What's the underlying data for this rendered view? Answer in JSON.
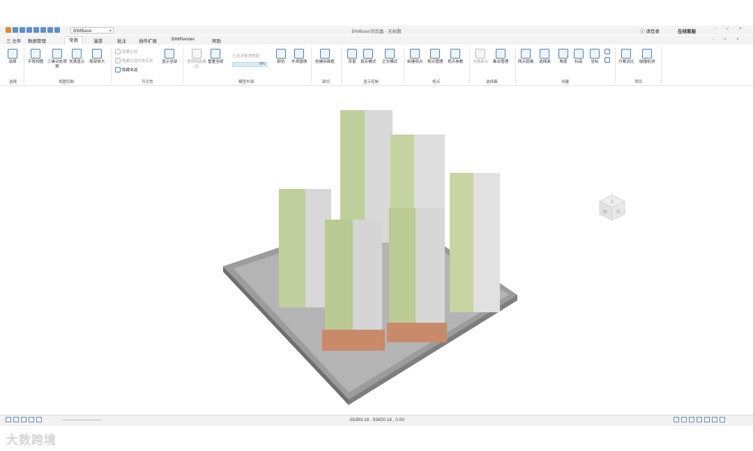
{
  "title_bar": {
    "workspace_combo": "BIMBase",
    "window_title": "BIMBase浏览器 - 无标题",
    "login": "请登录",
    "online_help": "在线客服",
    "window_controls": "- ♂ ×"
  },
  "menu": {
    "items": [
      "三 文件",
      "数据管理",
      "常用",
      "漫游",
      "批注",
      "插件扩展",
      "BIMRender",
      "帮助"
    ],
    "mdi_controls": "- ♂ ×"
  },
  "ribbon": {
    "select": "选择",
    "pan": "平移视图",
    "orbit": "三维动态观察",
    "fill_display": "充满显示",
    "zoom_local": "局部放大",
    "hide_selected": "隐藏已选",
    "hide_selected_similar": "隐藏已选同类实体",
    "hide_unselected": "隐藏未选",
    "show_all": "显示全部",
    "transparency_mode": "透明隔离模式",
    "reset_all": "重置全部",
    "selected_transparency": "已选对象透明度",
    "transparency_pct": "0%",
    "transparency_value": 0,
    "color": "颜色",
    "appearance_replace": "外观替换",
    "create_section_box": "创建剖面框",
    "background": "背景",
    "realistic_mode": "真实模式",
    "front_mode": "正交模式",
    "new_viewpoint": "新建视点",
    "viewpoint_manage": "视点管理",
    "viewpoint_params": "视点参数",
    "create_set": "创建集合",
    "set_manage": "集合管理",
    "two_point_distance": "两点距离",
    "select_surface": "选择面",
    "angle": "角度",
    "elevation": "标高",
    "coordinate": "坐标",
    "scheme_compare": "方案对比",
    "clash_detect": "碰撞检测"
  },
  "groups": {
    "select": "选择",
    "view_control": "视图控制",
    "visibility": "可见性",
    "model_appearance": "模型外观",
    "section": "剖切",
    "display_control": "显示控制",
    "viewpoint": "视点",
    "selection_set": "选择集",
    "measure": "测量",
    "project": "项目"
  },
  "viewport": {
    "navcube_faces": [
      "上",
      "前",
      "右"
    ]
  },
  "status": {
    "coordinates": "-55393.18 , 93820.18 , 0.00"
  },
  "watermark": "大数跨境"
}
